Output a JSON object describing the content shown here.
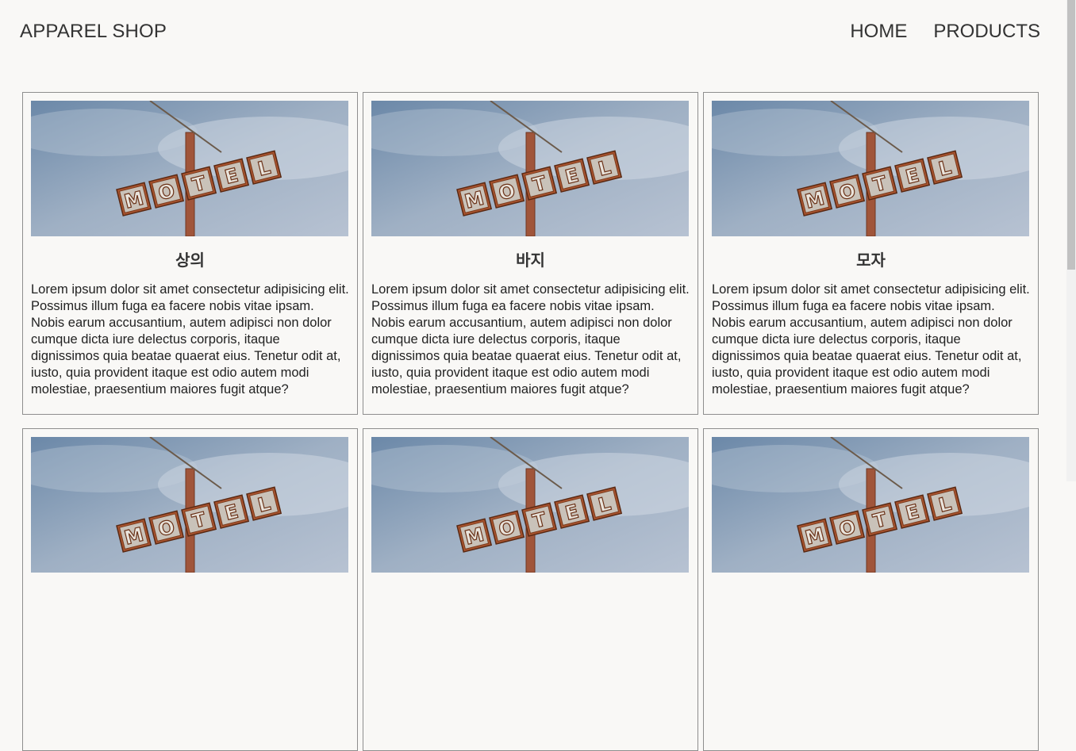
{
  "header": {
    "brand": "APPAREL SHOP",
    "nav": [
      {
        "label": "HOME"
      },
      {
        "label": "PRODUCTS"
      }
    ]
  },
  "products": [
    {
      "title": "상의",
      "description": "Lorem ipsum dolor sit amet consectetur adipisicing elit. Possimus illum fuga ea facere nobis vitae ipsam. Nobis earum accusantium, autem adipisci non dolor cumque dicta iure delectus corporis, itaque dignissimos quia beatae quaerat eius. Tenetur odit at, iusto, quia provident itaque est odio autem modi molestiae, praesentium maiores fugit atque?"
    },
    {
      "title": "바지",
      "description": "Lorem ipsum dolor sit amet consectetur adipisicing elit. Possimus illum fuga ea facere nobis vitae ipsam. Nobis earum accusantium, autem adipisci non dolor cumque dicta iure delectus corporis, itaque dignissimos quia beatae quaerat eius. Tenetur odit at, iusto, quia provident itaque est odio autem modi molestiae, praesentium maiores fugit atque?"
    },
    {
      "title": "모자",
      "description": "Lorem ipsum dolor sit amet consectetur adipisicing elit. Possimus illum fuga ea facere nobis vitae ipsam. Nobis earum accusantium, autem adipisci non dolor cumque dicta iure delectus corporis, itaque dignissimos quia beatae quaerat eius. Tenetur odit at, iusto, quia provident itaque est odio autem modi molestiae, praesentium maiores fugit atque?"
    },
    {
      "title": "",
      "description": ""
    },
    {
      "title": "",
      "description": ""
    },
    {
      "title": "",
      "description": ""
    }
  ],
  "image": {
    "sign_text": "MOTEL"
  },
  "colors": {
    "background": "#f9f8f6",
    "border": "#8e8e8e",
    "text": "#333333"
  }
}
